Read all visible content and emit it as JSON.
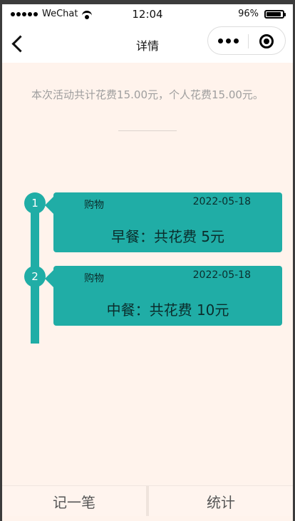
{
  "status_bar": {
    "carrier": "WeChat",
    "time": "12:04",
    "battery_percent": "96%"
  },
  "nav": {
    "title": "详情"
  },
  "summary": {
    "text": "本次活动共计花费15.00元，个人花费15.00元。"
  },
  "timeline": [
    {
      "index": "1",
      "category": "购物",
      "date": "2022-05-18",
      "text": "早餐：共花费 5元"
    },
    {
      "index": "2",
      "category": "购物",
      "date": "2022-05-18",
      "text": "中餐：共花费 10元"
    }
  ],
  "tabs": {
    "record": "记一笔",
    "stats": "统计"
  },
  "colors": {
    "accent": "#20ada6",
    "background": "#fff3ec"
  }
}
